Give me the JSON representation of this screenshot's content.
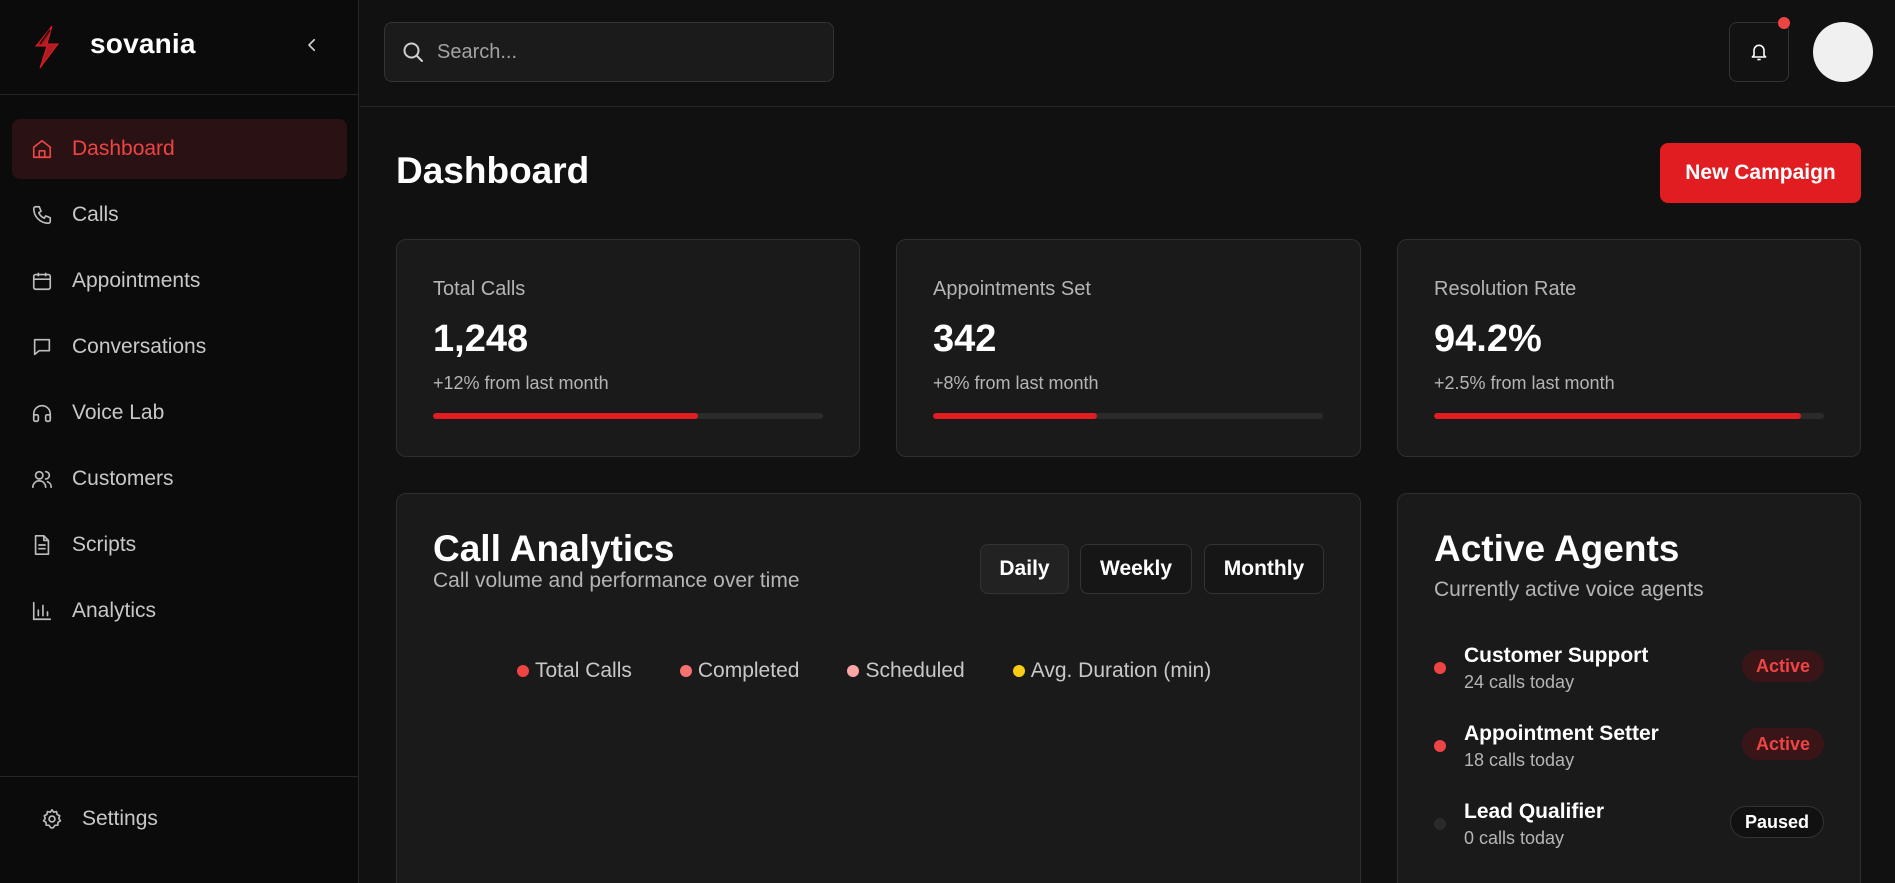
{
  "brand": {
    "name": "sovania"
  },
  "sidebar": {
    "items": [
      {
        "label": "Dashboard",
        "icon": "home-icon",
        "active": true
      },
      {
        "label": "Calls",
        "icon": "phone-icon"
      },
      {
        "label": "Appointments",
        "icon": "calendar-icon"
      },
      {
        "label": "Conversations",
        "icon": "chat-icon"
      },
      {
        "label": "Voice Lab",
        "icon": "headphones-icon"
      },
      {
        "label": "Customers",
        "icon": "users-icon"
      },
      {
        "label": "Scripts",
        "icon": "document-icon"
      },
      {
        "label": "Analytics",
        "icon": "bar-chart-icon"
      }
    ],
    "settings": {
      "label": "Settings",
      "icon": "gear-icon"
    }
  },
  "topbar": {
    "search": {
      "placeholder": "Search..."
    },
    "notification": {
      "unread": true
    }
  },
  "page": {
    "title": "Dashboard",
    "primary_action": "New Campaign"
  },
  "stats": [
    {
      "label": "Total Calls",
      "value": "1,248",
      "change": "+12% from last month",
      "progress": 0.68
    },
    {
      "label": "Appointments Set",
      "value": "342",
      "change": "+8% from last month",
      "progress": 0.42
    },
    {
      "label": "Resolution Rate",
      "value": "94.2%",
      "change": "+2.5% from last month",
      "progress": 0.942
    }
  ],
  "call_analytics": {
    "title": "Call Analytics",
    "subtitle": "Call volume and performance over time",
    "periods": [
      "Daily",
      "Weekly",
      "Monthly"
    ],
    "selected_period": "Daily",
    "legend": [
      {
        "name": "Total Calls",
        "color": "#ef4444"
      },
      {
        "name": "Completed",
        "color": "#f87171"
      },
      {
        "name": "Scheduled",
        "color": "#fca5a5"
      },
      {
        "name": "Avg. Duration (min)",
        "color": "#facc15"
      }
    ]
  },
  "active_agents": {
    "title": "Active Agents",
    "subtitle": "Currently active voice agents",
    "agents": [
      {
        "name": "Customer Support",
        "calls": "24 calls today",
        "status": "Active",
        "dot_color": "#ef4444"
      },
      {
        "name": "Appointment Setter",
        "calls": "18 calls today",
        "status": "Active",
        "dot_color": "#ef4444"
      },
      {
        "name": "Lead Qualifier",
        "calls": "0 calls today",
        "status": "Paused",
        "dot_color": "#2a2a2a"
      }
    ]
  },
  "colors": {
    "accent": "#e11d22",
    "background": "#111111",
    "card": "#1a1a1a"
  }
}
